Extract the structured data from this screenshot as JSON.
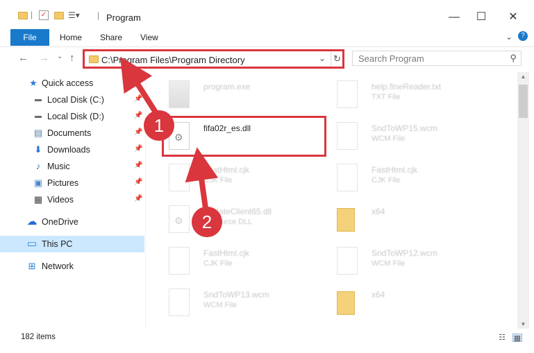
{
  "window": {
    "title": "Program",
    "minimize_glyph": "—",
    "maximize_glyph": "☐",
    "close_glyph": "✕"
  },
  "ribbon": {
    "tabs": [
      "File",
      "Home",
      "Share",
      "View"
    ],
    "expand_glyph": "⌄",
    "help_glyph": "?"
  },
  "address": {
    "path": "C:\\Program Files\\Program Directory",
    "refresh_glyph": "↻",
    "dropdown_glyph": "⌄"
  },
  "search": {
    "placeholder": "Search Program",
    "icon_glyph": "⚲"
  },
  "sidebar": {
    "items": [
      {
        "label": "Quick access",
        "icon": "star-icon",
        "glyph": "★",
        "color": "#2b7fd8",
        "pinned": false
      },
      {
        "label": "Local Disk (C:)",
        "icon": "drive-icon",
        "glyph": "▬",
        "color": "#6b6b6b",
        "pinned": true
      },
      {
        "label": "Local Disk (D:)",
        "icon": "drive-icon",
        "glyph": "▬",
        "color": "#6b6b6b",
        "pinned": true
      },
      {
        "label": "Documents",
        "icon": "documents-icon",
        "glyph": "▤",
        "color": "#5a7fa8",
        "pinned": true
      },
      {
        "label": "Downloads",
        "icon": "download-arrow-icon",
        "glyph": "⬇",
        "color": "#1f6fd1",
        "pinned": true
      },
      {
        "label": "Music",
        "icon": "music-note-icon",
        "glyph": "♪",
        "color": "#1f6fd1",
        "pinned": true
      },
      {
        "label": "Pictures",
        "icon": "pictures-icon",
        "glyph": "▣",
        "color": "#4a86c5",
        "pinned": true
      },
      {
        "label": "Videos",
        "icon": "film-icon",
        "glyph": "▦",
        "color": "#444444",
        "pinned": true
      },
      {
        "label": "OneDrive",
        "icon": "cloud-icon",
        "glyph": "☁",
        "color": "#1f6fd1",
        "pinned": false
      },
      {
        "label": "This PC",
        "icon": "monitor-icon",
        "glyph": "▭",
        "color": "#2b7fd8",
        "pinned": false
      },
      {
        "label": "Network",
        "icon": "network-icon",
        "glyph": "⊞",
        "color": "#2b7fd8",
        "pinned": false
      }
    ]
  },
  "files": [
    {
      "name": "program.exe",
      "type": "",
      "icon": "exe-icon",
      "faded": true
    },
    {
      "name": "help.fineReader.txt",
      "type": "TXT File",
      "icon": "text-file-icon",
      "faded": true
    },
    {
      "name": "fifa02r_es.dll",
      "type": "",
      "icon": "dll-gear-icon",
      "faded": false
    },
    {
      "name": "SndToWP15.wcm",
      "type": "WCM File",
      "icon": "file-icon",
      "faded": true
    },
    {
      "name": "FastHtml.cjk",
      "type": "CJK File",
      "icon": "file-icon",
      "faded": true
    },
    {
      "name": "FastHtml.cjk",
      "type": "CJK File",
      "icon": "file-icon",
      "faded": true
    },
    {
      "name": "UpdateClient65.dll",
      "type": "Resource DLL",
      "icon": "dll-gear-icon",
      "faded": true
    },
    {
      "name": "x64",
      "type": "",
      "icon": "folder-icon",
      "faded": true
    },
    {
      "name": "FastHtml.cjk",
      "type": "CJK File",
      "icon": "file-icon",
      "faded": true
    },
    {
      "name": "SndToWP12.wcm",
      "type": "WCM File",
      "icon": "file-icon",
      "faded": true
    },
    {
      "name": "SndToWP13.wcm",
      "type": "WCM File",
      "icon": "file-icon",
      "faded": true
    },
    {
      "name": "x64",
      "type": "",
      "icon": "folder-icon",
      "faded": true
    }
  ],
  "status": {
    "item_count": "182 items"
  },
  "annotations": {
    "step1": "1",
    "step2": "2",
    "color": "#d9363e"
  }
}
